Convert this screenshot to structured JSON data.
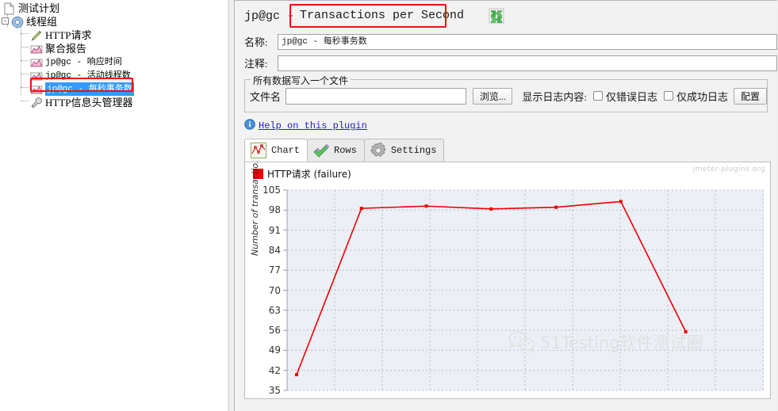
{
  "tree": {
    "items": [
      {
        "label": "测试计划",
        "icon": "test-plan-icon",
        "indent": 0,
        "selected": false,
        "mono": false
      },
      {
        "label": "线程组",
        "icon": "thread-group-icon",
        "indent": 1,
        "selected": false,
        "mono": false
      },
      {
        "label": "HTTP请求",
        "icon": "http-request-icon",
        "indent": 2,
        "selected": false,
        "mono": false
      },
      {
        "label": "聚合报告",
        "icon": "listener-icon",
        "indent": 2,
        "selected": false,
        "mono": false
      },
      {
        "label": "jp@gc - 响应时间",
        "icon": "listener-icon",
        "indent": 2,
        "selected": false,
        "mono": true
      },
      {
        "label": "jp@gc - 活动线程数",
        "icon": "listener-icon",
        "indent": 2,
        "selected": false,
        "mono": true
      },
      {
        "label": "jp@gc - 每秒事务数",
        "icon": "listener-icon",
        "indent": 2,
        "selected": true,
        "mono": true
      },
      {
        "label": "HTTP信息头管理器",
        "icon": "header-manager-icon",
        "indent": 2,
        "selected": false,
        "mono": false
      }
    ]
  },
  "header": {
    "title_prefix": "jp@gc -",
    "title_main": "Transactions per Second",
    "expand_icon": "puzzle-icon"
  },
  "form": {
    "name_label": "名称:",
    "name_value": "jp@gc - 每秒事务数",
    "comment_label": "注释:",
    "comment_value": "",
    "group_title": "所有数据写入一个文件",
    "file_label": "文件名",
    "file_value": "",
    "file_placeholder": "",
    "browse_button": "浏览...",
    "show_logs_label": "显示日志内容:",
    "checkbox_error_only": "仅错误日志",
    "checkbox_success_only": "仅成功日志",
    "configure_button": "配置",
    "help_link": "Help on this plugin",
    "help_icon": "info-icon"
  },
  "tabs": [
    {
      "label": "Chart",
      "icon": "chart-icon",
      "active": true
    },
    {
      "label": "Rows",
      "icon": "rows-check-icon",
      "active": false
    },
    {
      "label": "Settings",
      "icon": "gear-icon",
      "active": false
    }
  ],
  "chart_data": {
    "type": "line",
    "title": "",
    "legend": [
      {
        "name": "HTTP请求 (failure)",
        "color": "#ee0000"
      }
    ],
    "legend_position": "top-left",
    "watermark": "jmeter-plugins.org",
    "center_watermark": "51Testing软件测试圈",
    "center_watermark_icon": "wechat-icon",
    "xlabel": "",
    "ylabel": "Number of transactions /sec",
    "yticks": [
      105,
      98,
      91,
      84,
      77,
      70,
      63,
      56,
      49,
      42,
      35
    ],
    "ylim": [
      35,
      105
    ],
    "xticks": [],
    "grid": true,
    "series": [
      {
        "name": "HTTP请求 (failure)",
        "color": "#ee0000",
        "x": [
          0,
          1,
          2,
          3,
          4,
          5,
          6
        ],
        "values": [
          40.5,
          98.6,
          99.4,
          98.4,
          99.0,
          101.0,
          55.5
        ]
      }
    ]
  },
  "colors": {
    "accent_red": "#e81414",
    "series_red": "#ee0000",
    "selection_blue": "#3399ff",
    "link_blue": "#2222c8"
  }
}
